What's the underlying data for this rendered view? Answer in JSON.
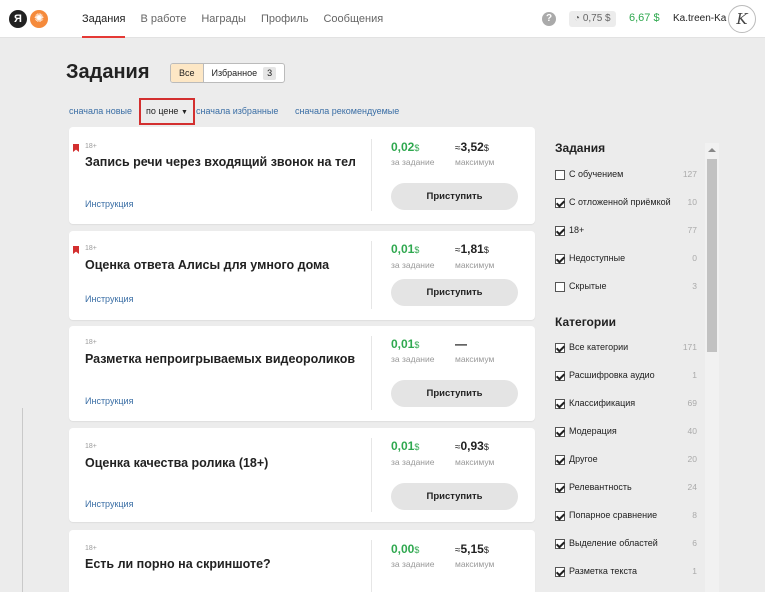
{
  "header": {
    "logo_letter": "Я",
    "logo_sun": "✺",
    "nav": [
      "Задания",
      "В работе",
      "Награды",
      "Профиль",
      "Сообщения"
    ],
    "help": "?",
    "bonus_balance": "◔ 0,75 $",
    "balance": "6,67 $",
    "username": "Ka.treen-Ka",
    "avatar_letter": "K"
  },
  "page": {
    "title": "Задания",
    "filters": {
      "all": "Все",
      "favorites": "Избранное",
      "favorites_count": "3"
    },
    "sort": {
      "newest": "сначала новые",
      "price": "по цене",
      "price_arrow": "▼",
      "favorites_first": "сначала избранные",
      "recommended_first": "сначала рекомендуемые"
    }
  },
  "tasks": [
    {
      "age": "18+",
      "title": "Запись речи через входящий звонок на теле...",
      "instruction": "Инструкция",
      "reward": "0,02",
      "reward_unit": "$",
      "reward_caption": "за задание",
      "max_prefix": "≈",
      "max": "3,52",
      "max_unit": "$",
      "max_caption": "максимум",
      "button": "Приступить",
      "bookmarked": true
    },
    {
      "age": "18+",
      "title": "Оценка ответа Алисы для умного дома",
      "instruction": "Инструкция",
      "reward": "0,01",
      "reward_unit": "$",
      "reward_caption": "за задание",
      "max_prefix": "≈",
      "max": "1,81",
      "max_unit": "$",
      "max_caption": "максимум",
      "button": "Приступить",
      "bookmarked": true
    },
    {
      "age": "18+",
      "title": "Разметка непроигрываемых видеороликов ...",
      "instruction": "Инструкция",
      "reward": "0,01",
      "reward_unit": "$",
      "reward_caption": "за задание",
      "max_prefix": "",
      "max": "—",
      "max_unit": "",
      "max_caption": "максимум",
      "button": "Приступить",
      "bookmarked": false
    },
    {
      "age": "18+",
      "title": "Оценка качества ролика (18+)",
      "instruction": "Инструкция",
      "reward": "0,01",
      "reward_unit": "$",
      "reward_caption": "за задание",
      "max_prefix": "≈",
      "max": "0,93",
      "max_unit": "$",
      "max_caption": "максимум",
      "button": "Приступить",
      "bookmarked": false
    },
    {
      "age": "18+",
      "title": "Есть ли порно на скриншоте?",
      "instruction": "",
      "reward": "0,00",
      "reward_unit": "$",
      "reward_caption": "за задание",
      "max_prefix": "≈",
      "max": "5,15",
      "max_unit": "$",
      "max_caption": "максимум",
      "button": "",
      "bookmarked": false
    }
  ],
  "sidebar": {
    "tasks_heading": "Задания",
    "task_filters": [
      {
        "label": "С обучением",
        "count": "127",
        "checked": false
      },
      {
        "label": "С отложенной приёмкой",
        "count": "10",
        "checked": true
      },
      {
        "label": "18+",
        "count": "77",
        "checked": true
      },
      {
        "label": "Недоступные",
        "count": "0",
        "checked": true
      },
      {
        "label": "Скрытые",
        "count": "3",
        "checked": false
      }
    ],
    "categories_heading": "Категории",
    "categories": [
      {
        "label": "Все категории",
        "count": "171",
        "checked": true
      },
      {
        "label": "Расшифровка аудио",
        "count": "1",
        "checked": true
      },
      {
        "label": "Классификация",
        "count": "69",
        "checked": true
      },
      {
        "label": "Модерация",
        "count": "40",
        "checked": true
      },
      {
        "label": "Другое",
        "count": "20",
        "checked": true
      },
      {
        "label": "Релевантность",
        "count": "24",
        "checked": true
      },
      {
        "label": "Попарное сравнение",
        "count": "8",
        "checked": true
      },
      {
        "label": "Выделение областей",
        "count": "6",
        "checked": true
      },
      {
        "label": "Разметка текста",
        "count": "1",
        "checked": true
      }
    ]
  },
  "colors": {
    "accent_red": "#e53935",
    "money_green": "#2fa84f",
    "link_blue": "#3a6ea5",
    "active_filter": "#fde7c5"
  }
}
